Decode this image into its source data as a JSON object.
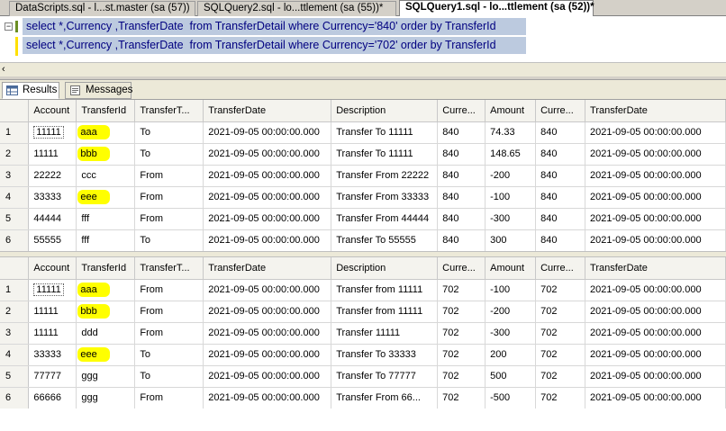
{
  "tabs": [
    {
      "label": "DataScripts.sql - l...st.master (sa (57))"
    },
    {
      "label": "SQLQuery2.sql - lo...ttlement (sa (55))*"
    },
    {
      "label": "SQLQuery1.sql - lo...ttlement (sa (52))*"
    }
  ],
  "editor": {
    "lines": [
      "select *,Currency ,TransferDate  from TransferDetail where Currency='840' order by TransferId",
      "select *,Currency ,TransferDate  from TransferDetail where Currency='702' order by TransferId"
    ]
  },
  "result_tabs": {
    "results": "Results",
    "messages": "Messages"
  },
  "grid_headers": [
    "Account",
    "TransferId",
    "TransferT...",
    "TransferDate",
    "Description",
    "Curre...",
    "Amount",
    "Curre...",
    "TransferDate"
  ],
  "grid1": [
    {
      "n": "1",
      "cells": [
        "11111",
        "aaa",
        "To",
        "2021-09-05 00:00:00.000",
        "Transfer To 11111",
        "840",
        "74.33",
        "840",
        "2021-09-05 00:00:00.000"
      ],
      "hl": true
    },
    {
      "n": "2",
      "cells": [
        "11111",
        "bbb",
        "To",
        "2021-09-05 00:00:00.000",
        "Transfer To 11111",
        "840",
        "148.65",
        "840",
        "2021-09-05 00:00:00.000"
      ],
      "hl": true
    },
    {
      "n": "3",
      "cells": [
        "22222",
        "ccc",
        "From",
        "2021-09-05 00:00:00.000",
        "Transfer From 22222",
        "840",
        "-200",
        "840",
        "2021-09-05 00:00:00.000"
      ],
      "hl": false
    },
    {
      "n": "4",
      "cells": [
        "33333",
        "eee",
        "From",
        "2021-09-05 00:00:00.000",
        "Transfer From 33333",
        "840",
        "-100",
        "840",
        "2021-09-05 00:00:00.000"
      ],
      "hl": true
    },
    {
      "n": "5",
      "cells": [
        "44444",
        "fff",
        "From",
        "2021-09-05 00:00:00.000",
        "Transfer From 44444",
        "840",
        "-300",
        "840",
        "2021-09-05 00:00:00.000"
      ],
      "hl": false
    },
    {
      "n": "6",
      "cells": [
        "55555",
        "fff",
        "To",
        "2021-09-05 00:00:00.000",
        "Transfer To 55555",
        "840",
        "300",
        "840",
        "2021-09-05 00:00:00.000"
      ],
      "hl": false
    }
  ],
  "grid2": [
    {
      "n": "1",
      "cells": [
        "11111",
        "aaa",
        "From",
        "2021-09-05 00:00:00.000",
        "Transfer from 11111",
        "702",
        "-100",
        "702",
        "2021-09-05 00:00:00.000"
      ],
      "hl": true
    },
    {
      "n": "2",
      "cells": [
        "11111",
        "bbb",
        "From",
        "2021-09-05 00:00:00.000",
        "Transfer from 11111",
        "702",
        "-200",
        "702",
        "2021-09-05 00:00:00.000"
      ],
      "hl": true
    },
    {
      "n": "3",
      "cells": [
        "11111",
        "ddd",
        "From",
        "2021-09-05 00:00:00.000",
        "Transfer 11111",
        "702",
        "-300",
        "702",
        "2021-09-05 00:00:00.000"
      ],
      "hl": false
    },
    {
      "n": "4",
      "cells": [
        "33333",
        "eee",
        "To",
        "2021-09-05 00:00:00.000",
        "Transfer To 33333",
        "702",
        "200",
        "702",
        "2021-09-05 00:00:00.000"
      ],
      "hl": true
    },
    {
      "n": "5",
      "cells": [
        "77777",
        "ggg",
        "To",
        "2021-09-05 00:00:00.000",
        "Transfer To 77777",
        "702",
        "500",
        "702",
        "2021-09-05 00:00:00.000"
      ],
      "hl": false
    },
    {
      "n": "6",
      "cells": [
        "66666",
        "ggg",
        "From",
        "2021-09-05 00:00:00.000",
        "Transfer From 66...",
        "702",
        "-500",
        "702",
        "2021-09-05 00:00:00.000"
      ],
      "hl": false
    }
  ],
  "colors": {
    "highlight": "#ffff00",
    "selection": "#bccadf",
    "code_text": "#000080"
  }
}
